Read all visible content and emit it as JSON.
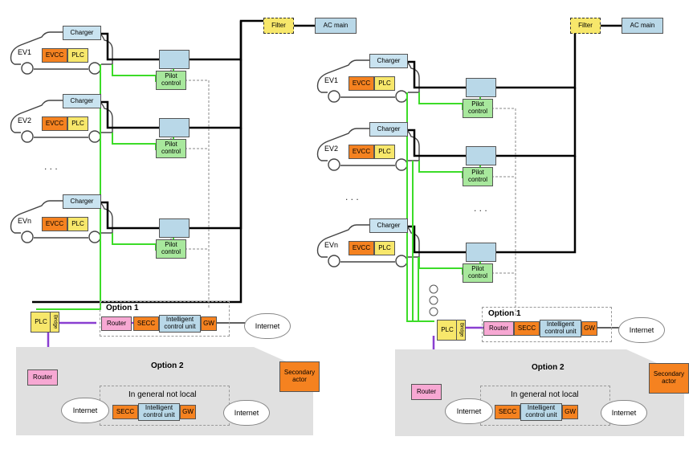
{
  "ev_labels": {
    "ev1": "EV1",
    "ev2": "EV2",
    "evn": "EVn"
  },
  "comp": {
    "charger": "Charger",
    "evcc": "EVCC",
    "plc": "PLC",
    "pilot": "Pilot control",
    "filter": "Filter",
    "acmain": "AC main",
    "router": "Router",
    "secc": "SECC",
    "icu": "Intelligent control unit",
    "gw": "GW",
    "internet": "Internet",
    "secondary": "Secondary actor",
    "plc_bridge": "PLC Bridge",
    "bridge": "Bridge"
  },
  "options": {
    "opt1": "Option 1",
    "opt2": "Option 2",
    "notlocal": "In general not local"
  },
  "ellipsis": ". . ."
}
